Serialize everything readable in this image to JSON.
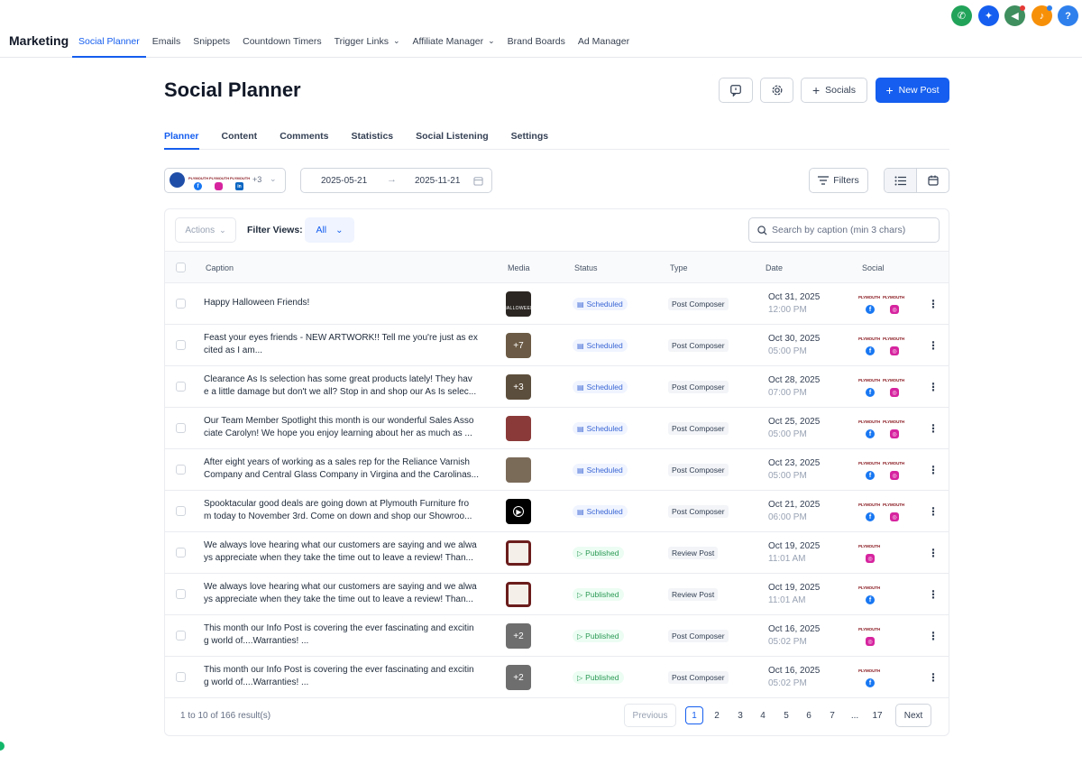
{
  "app": {
    "title": "Marketing"
  },
  "top_nav": {
    "items": [
      {
        "label": "Social Planner",
        "active": true,
        "has_dropdown": false
      },
      {
        "label": "Emails",
        "active": false,
        "has_dropdown": false
      },
      {
        "label": "Snippets",
        "active": false,
        "has_dropdown": false
      },
      {
        "label": "Countdown Timers",
        "active": false,
        "has_dropdown": false
      },
      {
        "label": "Trigger Links",
        "active": false,
        "has_dropdown": true
      },
      {
        "label": "Affiliate Manager",
        "active": false,
        "has_dropdown": true
      },
      {
        "label": "Brand Boards",
        "active": false,
        "has_dropdown": false
      },
      {
        "label": "Ad Manager",
        "active": false,
        "has_dropdown": false
      }
    ],
    "quick_actions": [
      {
        "icon": "phone-icon",
        "color": "#22a35a"
      },
      {
        "icon": "sparkle-icon",
        "color": "#155eef"
      },
      {
        "icon": "megaphone-icon",
        "color": "#3f8f5f"
      },
      {
        "icon": "bell-icon",
        "color": "#f79009"
      },
      {
        "icon": "help-icon",
        "color": "#2f80ed",
        "label": "?"
      }
    ]
  },
  "page": {
    "title": "Social Planner",
    "buttons": {
      "socials_label": "Socials",
      "new_post_label": "New Post"
    }
  },
  "tabs": [
    {
      "label": "Planner",
      "active": true
    },
    {
      "label": "Content",
      "active": false
    },
    {
      "label": "Comments",
      "active": false
    },
    {
      "label": "Statistics",
      "active": false
    },
    {
      "label": "Social Listening",
      "active": false
    },
    {
      "label": "Settings",
      "active": false
    }
  ],
  "controls": {
    "accounts_more": "+3",
    "date_from": "2025-05-21",
    "date_to": "2025-11-21",
    "filters_label": "Filters"
  },
  "table_toolbar": {
    "actions_label": "Actions",
    "filter_views_label": "Filter Views:",
    "filter_views_value": "All",
    "search_placeholder": "Search by caption (min 3 chars)"
  },
  "columns": [
    "Caption",
    "Media",
    "Status",
    "Type",
    "Date",
    "Social"
  ],
  "rows": [
    {
      "caption": [
        "Happy Halloween Friends!",
        ""
      ],
      "media": {
        "kind": "image",
        "text": "HALLOWEEN",
        "color": "#2b2622"
      },
      "status": "Scheduled",
      "type": "Post Composer",
      "date": "Oct 31, 2025",
      "time": "12:00 PM",
      "networks": [
        "facebook",
        "instagram"
      ]
    },
    {
      "caption": [
        "Feast your eyes friends - NEW ARTWORK!! Tell me you're just as ex",
        "cited as I am..."
      ],
      "media": {
        "kind": "more",
        "text": "+7",
        "color": "#6b5a45"
      },
      "status": "Scheduled",
      "type": "Post Composer",
      "date": "Oct 30, 2025",
      "time": "05:00 PM",
      "networks": [
        "facebook",
        "instagram"
      ]
    },
    {
      "caption": [
        "Clearance As Is selection has some great products lately! They hav",
        "e a little damage but don't we all? Stop in and shop our As Is selec..."
      ],
      "media": {
        "kind": "more",
        "text": "+3",
        "color": "#5c4e3c"
      },
      "status": "Scheduled",
      "type": "Post Composer",
      "date": "Oct 28, 2025",
      "time": "07:00 PM",
      "networks": [
        "facebook",
        "instagram"
      ]
    },
    {
      "caption": [
        "Our Team Member Spotlight this month is our wonderful Sales Asso",
        "ciate Carolyn! We hope you enjoy learning about her as much as ..."
      ],
      "media": {
        "kind": "image",
        "text": "",
        "color": "#8b3a3a"
      },
      "status": "Scheduled",
      "type": "Post Composer",
      "date": "Oct 25, 2025",
      "time": "05:00 PM",
      "networks": [
        "facebook",
        "instagram"
      ]
    },
    {
      "caption": [
        "After eight years of working as a sales rep for the Reliance Varnish",
        "Company and Central Glass Company in Virgina and the Carolinas..."
      ],
      "media": {
        "kind": "image",
        "text": "",
        "color": "#7a6a58"
      },
      "status": "Scheduled",
      "type": "Post Composer",
      "date": "Oct 23, 2025",
      "time": "05:00 PM",
      "networks": [
        "facebook",
        "instagram"
      ]
    },
    {
      "caption": [
        "Spooktacular good deals are going down at Plymouth Furniture fro",
        "m today to November 3rd. Come on down and shop our Showroo..."
      ],
      "media": {
        "kind": "video",
        "text": "",
        "color": "#000000"
      },
      "status": "Scheduled",
      "type": "Post Composer",
      "date": "Oct 21, 2025",
      "time": "06:00 PM",
      "networks": [
        "facebook",
        "instagram"
      ]
    },
    {
      "caption": [
        "We always love hearing what our customers are saying and we alwa",
        "ys appreciate when they take the time out to leave a review! Than..."
      ],
      "media": {
        "kind": "frame",
        "text": "",
        "color": "#6b1c1c"
      },
      "status": "Published",
      "type": "Review Post",
      "date": "Oct 19, 2025",
      "time": "11:01 AM",
      "networks": [
        "instagram"
      ]
    },
    {
      "caption": [
        "We always love hearing what our customers are saying and we alwa",
        "ys appreciate when they take the time out to leave a review! Than..."
      ],
      "media": {
        "kind": "frame",
        "text": "",
        "color": "#6b1c1c"
      },
      "status": "Published",
      "type": "Review Post",
      "date": "Oct 19, 2025",
      "time": "11:01 AM",
      "networks": [
        "facebook"
      ]
    },
    {
      "caption": [
        "This month our Info Post is covering the ever fascinating and excitin",
        "g world of....Warranties! ..."
      ],
      "media": {
        "kind": "more",
        "text": "+2",
        "color": "#6e6e6e"
      },
      "status": "Published",
      "type": "Post Composer",
      "date": "Oct 16, 2025",
      "time": "05:02 PM",
      "networks": [
        "instagram"
      ]
    },
    {
      "caption": [
        "This month our Info Post is covering the ever fascinating and excitin",
        "g world of....Warranties! ..."
      ],
      "media": {
        "kind": "more",
        "text": "+2",
        "color": "#6e6e6e"
      },
      "status": "Published",
      "type": "Post Composer",
      "date": "Oct 16, 2025",
      "time": "05:02 PM",
      "networks": [
        "facebook"
      ]
    }
  ],
  "pagination": {
    "info": "1 to 10 of 166 result(s)",
    "previous_label": "Previous",
    "next_label": "Next",
    "pages": [
      "1",
      "2",
      "3",
      "4",
      "5",
      "6",
      "7",
      "...",
      "17"
    ],
    "current": "1"
  },
  "social_logo_text": "PLYMOUTH",
  "colors": {
    "accent": "#155eef",
    "scheduled": "#3b66d4",
    "published": "#2b9a55"
  }
}
